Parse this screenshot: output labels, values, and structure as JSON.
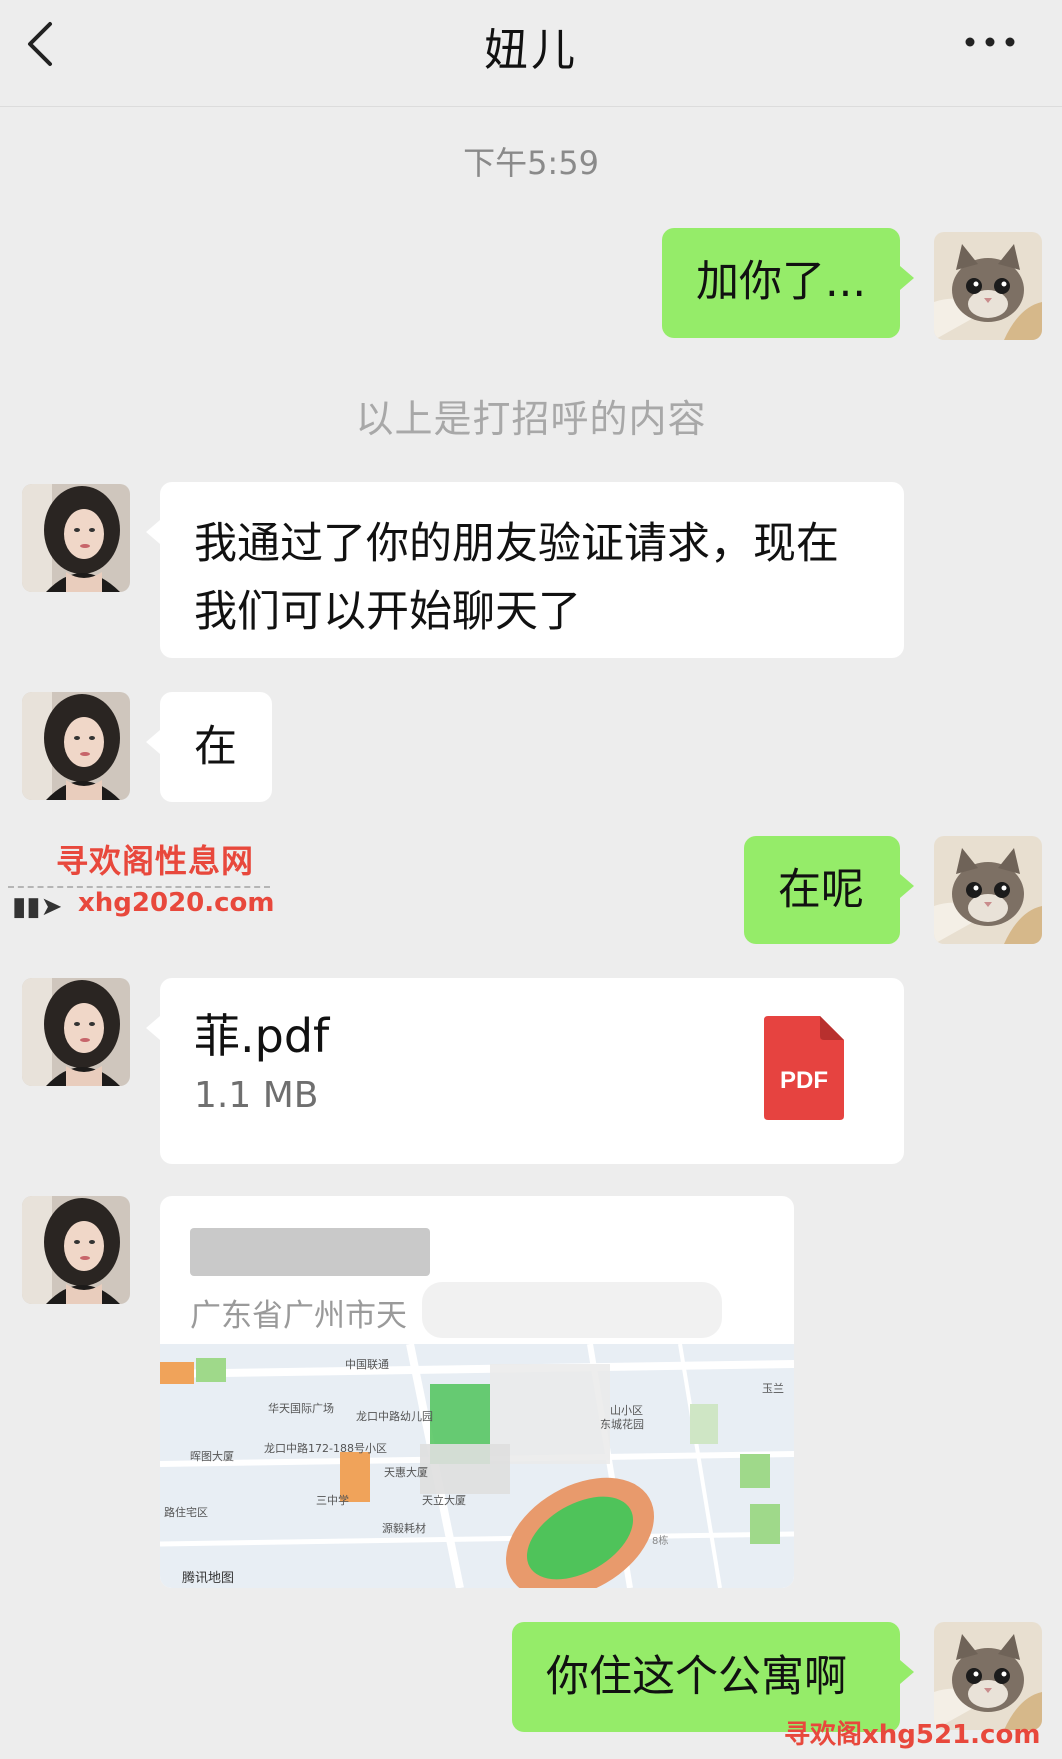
{
  "header": {
    "back_icon": "chevron-left-icon",
    "title": "妞儿",
    "more_icon": "more-dots-icon"
  },
  "timestamp": "下午5:59",
  "messages": [
    {
      "side": "right",
      "text": "加你了..."
    },
    {
      "side": "left",
      "text": "我通过了你的朋友验证请求，现在我们可以开始聊天了"
    },
    {
      "side": "left",
      "text": "在"
    },
    {
      "side": "right",
      "text": "在呢"
    },
    {
      "side": "left",
      "type": "file",
      "file_name": "菲.pdf",
      "file_size": "1.1 MB",
      "file_icon": "pdf-file-icon",
      "file_icon_label": "PDF"
    },
    {
      "side": "left",
      "type": "location",
      "address": "广东省广州市天"
    },
    {
      "side": "right",
      "text": "你住这个公寓啊"
    }
  ],
  "system_notice": "以上是打招呼的内容",
  "map_labels": {
    "l1": "中国联通",
    "l2": "华天国际广场",
    "l3": "龙口中路幼儿园",
    "l4": "龙口中路172-188号小区",
    "l5": "晖图大厦",
    "l6": "天惠大厦",
    "l7": "天立大厦",
    "l8": "源毅耗材",
    "l9": "三中学",
    "l10": "路住宅区",
    "l11": "东城花园",
    "l12": "山小区",
    "l13": "腾讯地图",
    "l14": "8栋",
    "l15": "玉兰"
  },
  "watermark": {
    "top_cn": "寻欢阁性息网",
    "top_url": "xhg2020.com",
    "bottom": "寻欢阁xhg521.com"
  },
  "colors": {
    "background": "#ededed",
    "green_bubble": "#95ec69",
    "white_bubble": "#ffffff",
    "pdf_red": "#e64340",
    "watermark_red": "#e8483c"
  }
}
